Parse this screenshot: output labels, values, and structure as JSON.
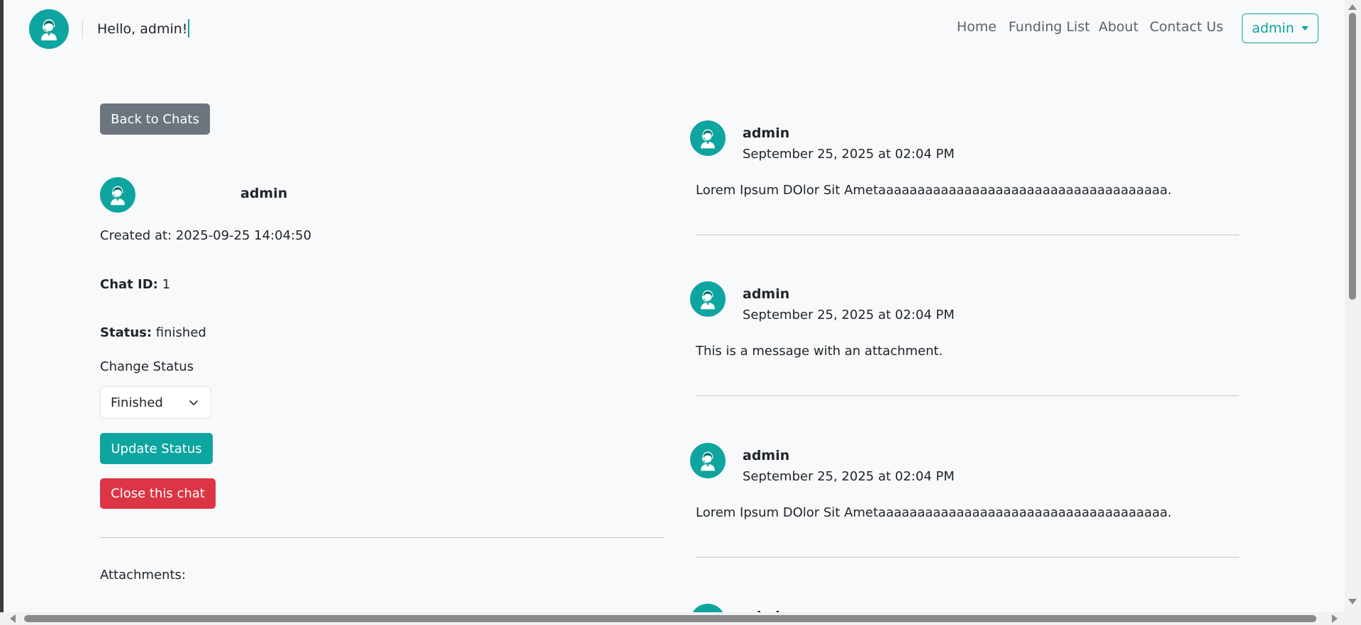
{
  "navbar": {
    "greeting": "Hello, admin!",
    "links": [
      "Home",
      "Funding List",
      "About",
      "Contact Us"
    ],
    "user_menu_label": "admin"
  },
  "chat": {
    "back_label": "Back to Chats",
    "user_name": "admin",
    "created_label": "Created at:",
    "created_value": "2025-09-25 14:04:50",
    "chat_id_label": "Chat ID:",
    "chat_id_value": "1",
    "status_label": "Status:",
    "status_value": "finished",
    "change_status_label": "Change Status",
    "status_select_value": "Finished",
    "update_label": "Update Status",
    "close_label": "Close this chat",
    "attachments_label": "Attachments:"
  },
  "messages": [
    {
      "author": "admin",
      "time": "September 25, 2025 at 02:04 PM",
      "text": "Lorem Ipsum DOlor Sit Ametaaaaaaaaaaaaaaaaaaaaaaaaaaaaaaaaaaaaa."
    },
    {
      "author": "admin",
      "time": "September 25, 2025 at 02:04 PM",
      "text": "This is a message with an attachment."
    },
    {
      "author": "admin",
      "time": "September 25, 2025 at 02:04 PM",
      "text": "Lorem Ipsum DOlor Sit Ametaaaaaaaaaaaaaaaaaaaaaaaaaaaaaaaaaaaaa."
    },
    {
      "author": "admin"
    }
  ],
  "colors": {
    "accent": "#0ea5a0",
    "secondary": "#6c757d",
    "danger": "#dc3545",
    "background": "#f8f9fa"
  },
  "icons": {
    "avatar": "user-avatar-icon",
    "caret": "caret-down-icon",
    "chevron": "chevron-down-icon"
  }
}
